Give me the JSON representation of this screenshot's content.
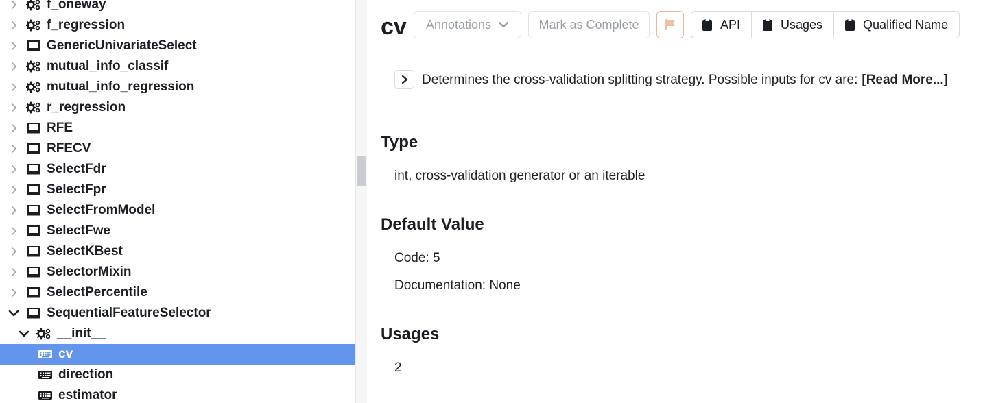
{
  "tree": {
    "items": [
      {
        "label": "f_oneway",
        "icon": "gears-icon",
        "expanded": false,
        "selected": false
      },
      {
        "label": "f_regression",
        "icon": "gears-icon",
        "expanded": false,
        "selected": false
      },
      {
        "label": "GenericUnivariateSelect",
        "icon": "laptop-icon",
        "expanded": false,
        "selected": false
      },
      {
        "label": "mutual_info_classif",
        "icon": "gears-icon",
        "expanded": false,
        "selected": false
      },
      {
        "label": "mutual_info_regression",
        "icon": "gears-icon",
        "expanded": false,
        "selected": false
      },
      {
        "label": "r_regression",
        "icon": "gears-icon",
        "expanded": false,
        "selected": false
      },
      {
        "label": "RFE",
        "icon": "laptop-icon",
        "expanded": false,
        "selected": false
      },
      {
        "label": "RFECV",
        "icon": "laptop-icon",
        "expanded": false,
        "selected": false
      },
      {
        "label": "SelectFdr",
        "icon": "laptop-icon",
        "expanded": false,
        "selected": false
      },
      {
        "label": "SelectFpr",
        "icon": "laptop-icon",
        "expanded": false,
        "selected": false
      },
      {
        "label": "SelectFromModel",
        "icon": "laptop-icon",
        "expanded": false,
        "selected": false
      },
      {
        "label": "SelectFwe",
        "icon": "laptop-icon",
        "expanded": false,
        "selected": false
      },
      {
        "label": "SelectKBest",
        "icon": "laptop-icon",
        "expanded": false,
        "selected": false
      },
      {
        "label": "SelectorMixin",
        "icon": "laptop-icon",
        "expanded": false,
        "selected": false
      },
      {
        "label": "SelectPercentile",
        "icon": "laptop-icon",
        "expanded": false,
        "selected": false
      },
      {
        "label": "SequentialFeatureSelector",
        "icon": "laptop-icon",
        "expanded": true,
        "selected": false
      },
      {
        "label": "__init__",
        "icon": "gears-icon",
        "expanded": true,
        "selected": false
      },
      {
        "label": "cv",
        "icon": "keyboard-icon",
        "expanded": null,
        "selected": true
      },
      {
        "label": "direction",
        "icon": "keyboard-icon",
        "expanded": null,
        "selected": false
      },
      {
        "label": "estimator",
        "icon": "keyboard-icon",
        "expanded": null,
        "selected": false
      }
    ]
  },
  "detail": {
    "title": "cv",
    "annotations_label": "Annotations",
    "mark_complete_label": "Mark as Complete",
    "api_label": "API",
    "usages_btn_label": "Usages",
    "qualified_name_label": "Qualified Name",
    "description": "Determines the cross-validation splitting strategy. Possible inputs for cv are:",
    "read_more": "[Read More...]",
    "type_heading": "Type",
    "type_value": "int, cross-validation generator or an iterable",
    "default_heading": "Default Value",
    "default_code": "Code: 5",
    "default_doc": "Documentation: None",
    "usages_heading": "Usages",
    "usages_count": "2"
  },
  "colors": {
    "selection": "#6495ed",
    "flag": "#f0c0a0",
    "text": "#1b1f24",
    "muted": "#9aa0a6"
  }
}
